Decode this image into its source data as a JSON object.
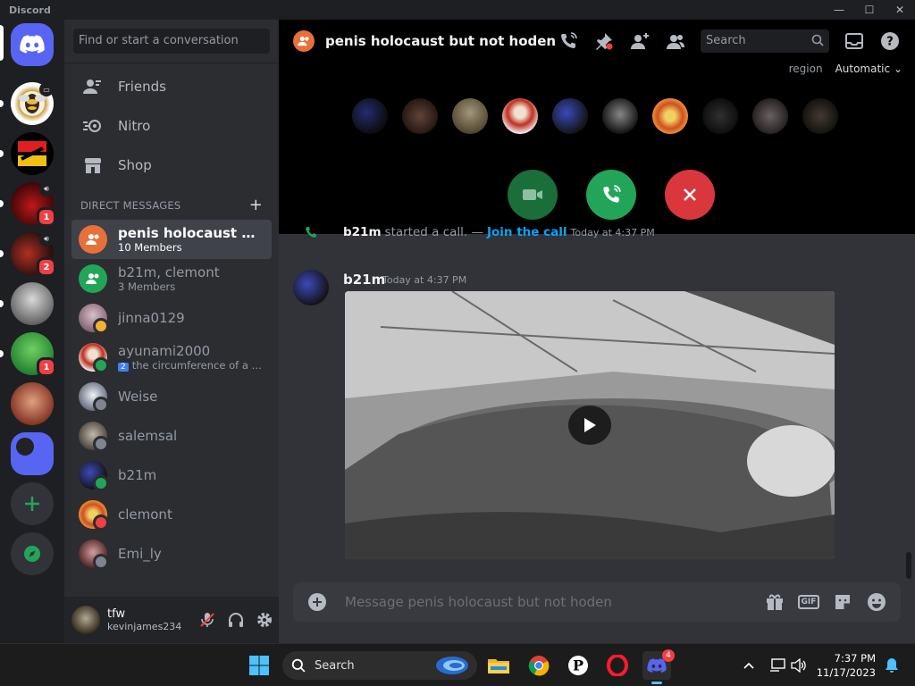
{
  "window": {
    "brand": "Discord",
    "controls": [
      "—",
      "☐",
      "✕"
    ]
  },
  "rail": {
    "badges": [
      "1",
      "2",
      "1"
    ]
  },
  "dm": {
    "search_placeholder": "Find or start a conversation",
    "nav": [
      {
        "label": "Friends",
        "icon": "friends-icon"
      },
      {
        "label": "Nitro",
        "icon": "nitro-icon"
      },
      {
        "label": "Shop",
        "icon": "shop-icon"
      }
    ],
    "section_title": "DIRECT MESSAGES",
    "conversations": [
      {
        "name": "penis holocaust but n...",
        "sub": "10 Members",
        "active": true
      },
      {
        "name": "b21m, clemont",
        "sub": "3 Members"
      },
      {
        "name": "jinna0129",
        "sub": ""
      },
      {
        "name": "ayunami2000",
        "sub": "the circumference of a roll...",
        "sub_badge": "2"
      },
      {
        "name": "Weise",
        "sub": ""
      },
      {
        "name": "salemsal",
        "sub": ""
      },
      {
        "name": "b21m",
        "sub": ""
      },
      {
        "name": "clemont",
        "sub": ""
      },
      {
        "name": "Emi_ly",
        "sub": ""
      }
    ]
  },
  "user": {
    "name": "tfw",
    "tag": "kevinjames234"
  },
  "channel": {
    "title": "penis holocaust but not hoden",
    "search_placeholder": "Search",
    "region_label": "region",
    "region_value": "Automatic"
  },
  "messages": {
    "system": {
      "author": "b21m",
      "text": "started a call. —",
      "link": "Join the call",
      "time": "Today at 4:37 PM"
    },
    "post": {
      "author": "b21m",
      "time": "Today at 4:37 PM"
    }
  },
  "composer": {
    "placeholder": "Message penis holocaust but not hoden",
    "gif_label": "GIF"
  },
  "taskbar": {
    "search_label": "Search",
    "discord_badge": "4",
    "time": "7:37 PM",
    "date": "11/17/2023"
  },
  "colors": {
    "blurple": "#5865f2",
    "online": "#23a559",
    "dnd": "#f23f43",
    "idle": "#f0b232",
    "offline": "#80848e",
    "hangup": "#da373c",
    "join": "#23a559"
  }
}
